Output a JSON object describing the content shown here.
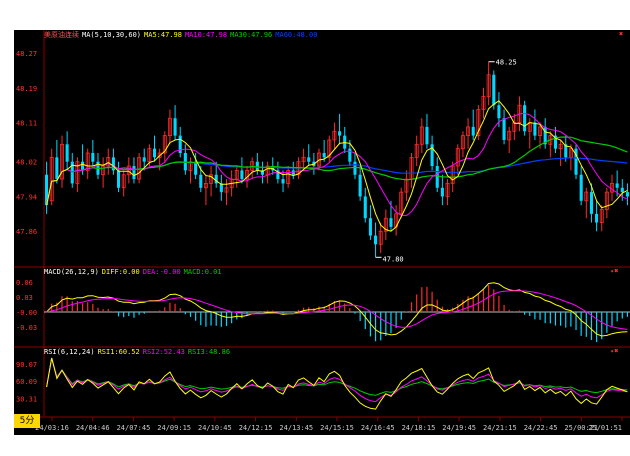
{
  "colors": {
    "background": "#000000",
    "axis": "#8b0000",
    "up": "#ff2a2a",
    "down": "#00d8ff",
    "ma5": "#ffff00",
    "ma10": "#ff00ff",
    "ma30": "#00cc00",
    "ma60": "#0040ff",
    "axis_text": "#ff3333",
    "time_text": "#cccccc",
    "annotation": "#ffffff",
    "badge": "#ffd700"
  },
  "header": {
    "symbol": "美原油连续",
    "ma_label": "MA(5,10,30,60)",
    "ma5": "MA5:47.98",
    "ma10": "MA10:47.98",
    "ma30": "MA30:47.96",
    "ma60": "MA60:48.00",
    "close": "✖"
  },
  "price_axis": [
    "48.27",
    "48.19",
    "48.11",
    "48.02",
    "47.94",
    "47.86"
  ],
  "annotations": {
    "high": "48.25",
    "low": "47.80"
  },
  "macd": {
    "label": "MACD(26,12,9)",
    "diff": "DIFF:0.00",
    "dea": "DEA:-0.00",
    "macd": "MACD:0.01",
    "axis": [
      "0.06",
      "0.03",
      "-0.00",
      "-0.03"
    ]
  },
  "rsi": {
    "label": "RSI(6,12,24)",
    "rsi1": "RSI1:60.52",
    "rsi2": "RSI2:52.43",
    "rsi3": "RSI3:48.86",
    "axis": [
      "90.07",
      "60.09",
      "30.31"
    ]
  },
  "timeframe": "5分",
  "time_axis": [
    "24/03:16",
    "24/04:46",
    "24/07:45",
    "24/09:15",
    "24/10:45",
    "24/12:15",
    "24/13:45",
    "24/15:15",
    "24/16:45",
    "24/18:15",
    "24/19:45",
    "24/21:15",
    "24/22:45",
    "25/00:21",
    "25/01:51"
  ],
  "chart_data": {
    "type": "candlestick",
    "title": "美原油连续",
    "ylim": [
      47.78,
      48.3
    ],
    "candles": [
      [
        47.99,
        48.02,
        47.9,
        47.92
      ],
      [
        47.93,
        48.05,
        47.92,
        48.03
      ],
      [
        48.03,
        48.07,
        47.97,
        47.98
      ],
      [
        47.98,
        48.08,
        47.96,
        48.06
      ],
      [
        48.06,
        48.09,
        48.0,
        48.02
      ],
      [
        48.02,
        48.04,
        47.96,
        47.97
      ],
      [
        47.97,
        48.03,
        47.95,
        48.02
      ],
      [
        48.02,
        48.06,
        47.99,
        48.0
      ],
      [
        48.0,
        48.05,
        47.98,
        48.04
      ],
      [
        48.04,
        48.07,
        48.01,
        48.02
      ],
      [
        48.02,
        48.04,
        47.98,
        47.99
      ],
      [
        47.99,
        48.03,
        47.96,
        48.01
      ],
      [
        48.01,
        48.05,
        47.99,
        48.03
      ],
      [
        48.03,
        48.05,
        47.99,
        48.0
      ],
      [
        48.0,
        48.02,
        47.95,
        47.96
      ],
      [
        47.96,
        48.0,
        47.94,
        47.99
      ],
      [
        47.99,
        48.03,
        47.97,
        48.01
      ],
      [
        48.01,
        48.03,
        47.97,
        47.98
      ],
      [
        47.98,
        48.04,
        47.97,
        48.03
      ],
      [
        48.03,
        48.05,
        48.0,
        48.02
      ],
      [
        48.02,
        48.06,
        48.01,
        48.05
      ],
      [
        48.05,
        48.08,
        48.02,
        48.03
      ],
      [
        48.03,
        48.05,
        48.0,
        48.04
      ],
      [
        48.04,
        48.09,
        48.02,
        48.08
      ],
      [
        48.08,
        48.14,
        48.06,
        48.12
      ],
      [
        48.12,
        48.15,
        48.07,
        48.08
      ],
      [
        48.08,
        48.1,
        48.03,
        48.04
      ],
      [
        48.04,
        48.06,
        47.99,
        48.0
      ],
      [
        48.0,
        48.03,
        47.97,
        48.02
      ],
      [
        48.02,
        48.04,
        47.98,
        47.99
      ],
      [
        47.99,
        48.01,
        47.95,
        47.96
      ],
      [
        47.96,
        47.99,
        47.92,
        47.97
      ],
      [
        47.97,
        48.01,
        47.94,
        47.99
      ],
      [
        47.99,
        48.02,
        47.96,
        47.97
      ],
      [
        47.97,
        47.99,
        47.93,
        47.95
      ],
      [
        47.95,
        47.98,
        47.92,
        47.96
      ],
      [
        47.96,
        48.0,
        47.94,
        47.98
      ],
      [
        47.98,
        48.01,
        47.96,
        48.0
      ],
      [
        48.0,
        48.03,
        47.97,
        47.98
      ],
      [
        47.98,
        48.01,
        47.96,
        48.0
      ],
      [
        48.0,
        48.03,
        47.98,
        48.02
      ],
      [
        48.02,
        48.04,
        47.99,
        48.0
      ],
      [
        48.0,
        48.02,
        47.97,
        47.99
      ],
      [
        47.99,
        48.02,
        47.97,
        48.01
      ],
      [
        48.01,
        48.03,
        47.99,
        48.0
      ],
      [
        48.0,
        48.02,
        47.97,
        47.98
      ],
      [
        47.98,
        48.0,
        47.95,
        47.97
      ],
      [
        47.97,
        48.01,
        47.96,
        48.0
      ],
      [
        48.0,
        48.02,
        47.98,
        47.99
      ],
      [
        47.99,
        48.03,
        47.98,
        48.02
      ],
      [
        48.02,
        48.05,
        48.0,
        48.03
      ],
      [
        48.03,
        48.06,
        48.01,
        48.02
      ],
      [
        48.02,
        48.04,
        47.99,
        48.01
      ],
      [
        48.01,
        48.05,
        48.0,
        48.04
      ],
      [
        48.04,
        48.07,
        48.02,
        48.03
      ],
      [
        48.03,
        48.08,
        48.02,
        48.07
      ],
      [
        48.07,
        48.11,
        48.05,
        48.09
      ],
      [
        48.09,
        48.13,
        48.06,
        48.08
      ],
      [
        48.08,
        48.1,
        48.04,
        48.05
      ],
      [
        48.05,
        48.07,
        48.01,
        48.02
      ],
      [
        48.02,
        48.04,
        47.98,
        47.99
      ],
      [
        47.99,
        48.01,
        47.93,
        47.94
      ],
      [
        47.94,
        47.96,
        47.88,
        47.89
      ],
      [
        47.89,
        47.92,
        47.84,
        47.85
      ],
      [
        47.85,
        47.88,
        47.8,
        47.83
      ],
      [
        47.83,
        47.88,
        47.81,
        47.86
      ],
      [
        47.86,
        47.91,
        47.84,
        47.89
      ],
      [
        47.89,
        47.93,
        47.86,
        47.87
      ],
      [
        47.87,
        47.92,
        47.85,
        47.9
      ],
      [
        47.9,
        47.96,
        47.89,
        47.95
      ],
      [
        47.95,
        48.0,
        47.93,
        47.98
      ],
      [
        47.98,
        48.04,
        47.96,
        48.03
      ],
      [
        48.03,
        48.08,
        48.01,
        48.06
      ],
      [
        48.06,
        48.12,
        48.04,
        48.1
      ],
      [
        48.1,
        48.13,
        48.05,
        48.06
      ],
      [
        48.06,
        48.08,
        48.0,
        48.01
      ],
      [
        48.01,
        48.03,
        47.95,
        47.96
      ],
      [
        47.96,
        47.99,
        47.92,
        47.94
      ],
      [
        47.94,
        47.98,
        47.92,
        47.97
      ],
      [
        47.97,
        48.02,
        47.95,
        48.01
      ],
      [
        48.01,
        48.06,
        47.99,
        48.05
      ],
      [
        48.05,
        48.09,
        48.03,
        48.08
      ],
      [
        48.08,
        48.12,
        48.05,
        48.1
      ],
      [
        48.1,
        48.14,
        48.07,
        48.08
      ],
      [
        48.08,
        48.15,
        48.07,
        48.14
      ],
      [
        48.14,
        48.19,
        48.12,
        48.17
      ],
      [
        48.17,
        48.25,
        48.15,
        48.22
      ],
      [
        48.22,
        48.23,
        48.14,
        48.15
      ],
      [
        48.15,
        48.18,
        48.1,
        48.12
      ],
      [
        48.12,
        48.14,
        48.06,
        48.07
      ],
      [
        48.07,
        48.1,
        48.04,
        48.09
      ],
      [
        48.09,
        48.13,
        48.07,
        48.11
      ],
      [
        48.11,
        48.17,
        48.09,
        48.15
      ],
      [
        48.15,
        48.16,
        48.08,
        48.09
      ],
      [
        48.09,
        48.12,
        48.05,
        48.11
      ],
      [
        48.11,
        48.14,
        48.07,
        48.08
      ],
      [
        48.08,
        48.11,
        48.05,
        48.1
      ],
      [
        48.1,
        48.12,
        48.05,
        48.06
      ],
      [
        48.06,
        48.09,
        48.03,
        48.08
      ],
      [
        48.08,
        48.1,
        48.04,
        48.05
      ],
      [
        48.05,
        48.07,
        48.01,
        48.06
      ],
      [
        48.06,
        48.08,
        48.02,
        48.03
      ],
      [
        48.03,
        48.06,
        48.0,
        48.05
      ],
      [
        48.05,
        48.06,
        47.98,
        47.99
      ],
      [
        47.99,
        48.01,
        47.92,
        47.93
      ],
      [
        47.93,
        47.96,
        47.89,
        47.95
      ],
      [
        47.95,
        47.97,
        47.88,
        47.9
      ],
      [
        47.9,
        47.93,
        47.86,
        47.88
      ],
      [
        47.88,
        47.92,
        47.86,
        47.91
      ],
      [
        47.91,
        47.96,
        47.89,
        47.95
      ],
      [
        47.95,
        47.99,
        47.93,
        47.97
      ],
      [
        47.97,
        48.0,
        47.94,
        47.96
      ],
      [
        47.96,
        47.98,
        47.93,
        47.95
      ],
      [
        47.95,
        47.97,
        47.92,
        47.94
      ]
    ]
  }
}
